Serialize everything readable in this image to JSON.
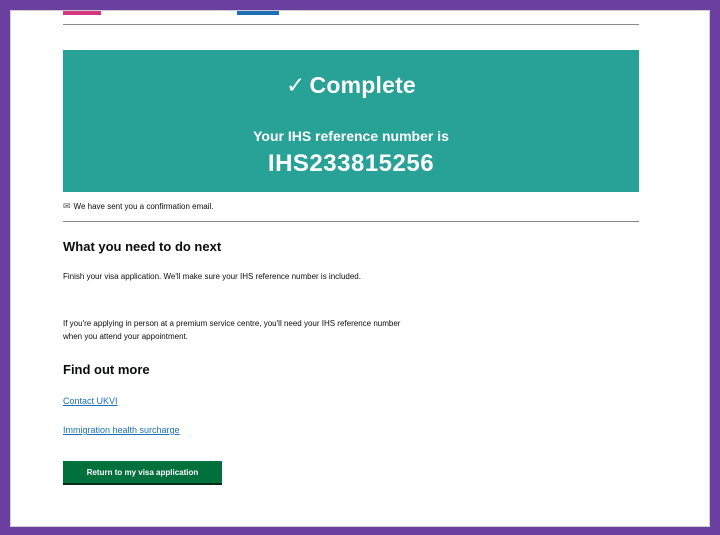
{
  "panel": {
    "title": "Complete",
    "tick": "✓",
    "subtitle": "Your IHS reference number is",
    "reference": "IHS233815256"
  },
  "email_notice": {
    "icon": "mail-icon",
    "text": "We have sent you a confirmation email."
  },
  "next_steps": {
    "heading": "What you need to do next",
    "paragraph1": "Finish your visa application. We'll make sure your IHS reference number is included.",
    "paragraph2": "If you're applying in person at a premium service centre, you'll need your IHS reference number when you attend your appointment."
  },
  "find_out_more": {
    "heading": "Find out more",
    "links": [
      "Contact UKVI",
      "Immigration health surcharge"
    ]
  },
  "return_button": "Return to my visa application",
  "colors": {
    "panel": "#28a197",
    "button": "#00703c",
    "link": "#1d70b8",
    "frame": "#6b3fa0"
  }
}
